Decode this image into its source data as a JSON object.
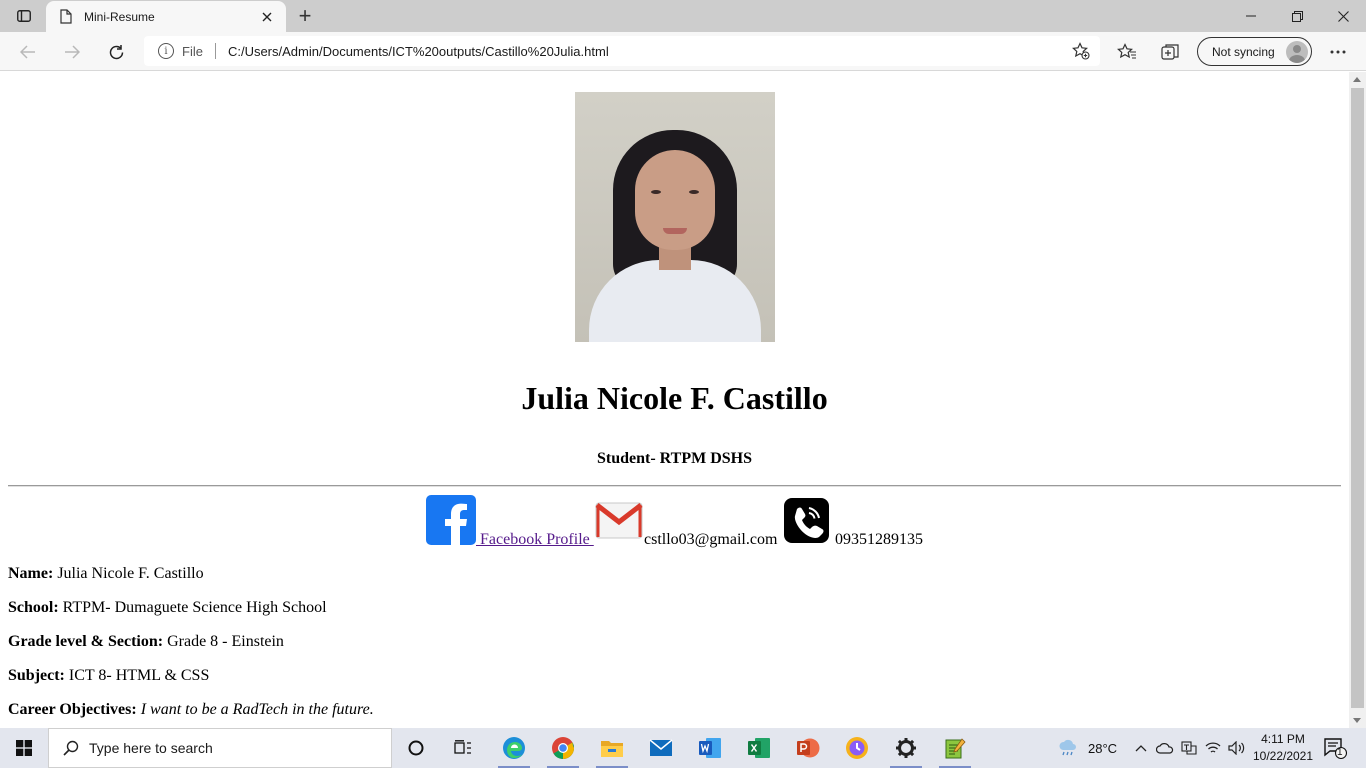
{
  "browser": {
    "tab_title": "Mini-Resume",
    "new_tab_symbol": "+",
    "address_scheme": "File",
    "address_url": "C:/Users/Admin/Documents/ICT%20outputs/Castillo%20Julia.html",
    "profile_label": "Not syncing",
    "icons": [
      "tab-actions-icon",
      "page-icon",
      "close-icon",
      "back-icon",
      "forward-icon",
      "refresh-icon",
      "info-icon",
      "add-favorite-icon",
      "favorites-icon",
      "collections-icon",
      "more-icon",
      "minimize-icon",
      "restore-icon",
      "window-close-icon"
    ]
  },
  "page": {
    "name": "Julia Nicole F. Castillo",
    "role": "Student- RTPM DSHS",
    "contacts": {
      "facebook_label": " Facebook Profile ",
      "email": "cstllo03@gmail.com",
      "phone": "09351289135"
    },
    "details": [
      {
        "label": "Name:",
        "value": " Julia Nicole F. Castillo"
      },
      {
        "label": "School:",
        "value": " RTPM- Dumaguete Science High School"
      },
      {
        "label": "Grade level & Section:",
        "value": " Grade 8 - Einstein"
      },
      {
        "label": "Subject:",
        "value": " ICT 8- HTML & CSS"
      },
      {
        "label": "Career Objectives:",
        "value": " I want to be a RadTech in the future."
      }
    ],
    "colors": {
      "facebook": "#1877f2",
      "link_visited": "#551a8b"
    }
  },
  "taskbar": {
    "search_placeholder": "Type here to search",
    "temperature": "28°C",
    "time": "4:11 PM",
    "date": "10/22/2021",
    "notification_count": "1",
    "apps": [
      "cortana-icon",
      "task-view-icon",
      "edge-icon",
      "chrome-icon",
      "file-explorer-icon",
      "mail-icon",
      "word-icon",
      "excel-icon",
      "powerpoint-icon",
      "vpn-icon",
      "settings-icon",
      "notepad-icon"
    ]
  }
}
